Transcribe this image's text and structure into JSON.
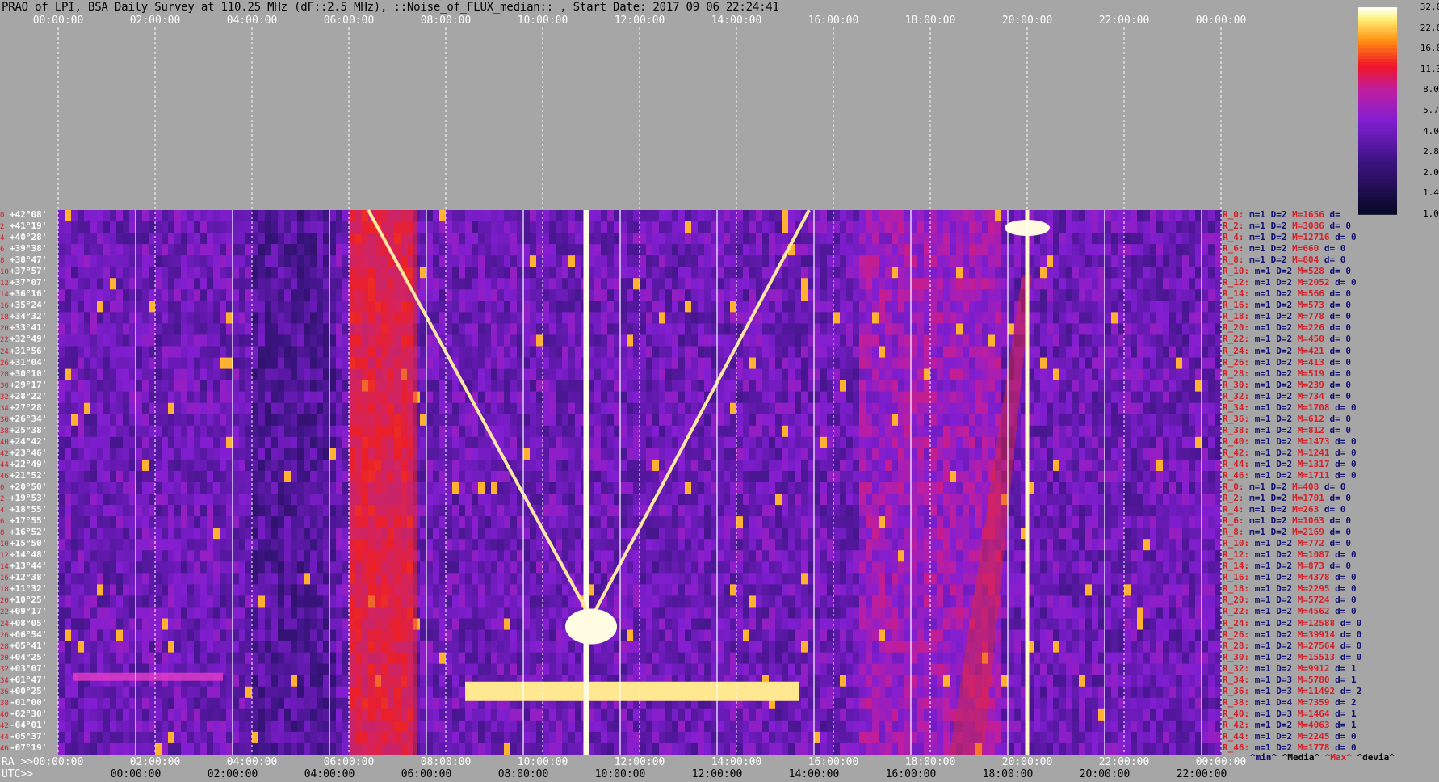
{
  "title": "PRAO of LPI, BSA Daily Survey at 110.25 MHz (dF::2.5 MHz), ::Noise_of_FLUX_median:: , Start Date: 2017 09 06 22:24:41",
  "top_axis": {
    "labels": [
      "00:00:00",
      "02:00:00",
      "04:00:00",
      "06:00:00",
      "08:00:00",
      "10:00:00",
      "12:00:00",
      "14:00:00",
      "16:00:00",
      "18:00:00",
      "20:00:00",
      "22:00:00",
      "00:00:00"
    ]
  },
  "ra_axis": {
    "prefix": "RA >>",
    "labels": [
      "00:00:00",
      "02:00:00",
      "04:00:00",
      "06:00:00",
      "08:00:00",
      "10:00:00",
      "12:00:00",
      "14:00:00",
      "16:00:00",
      "18:00:00",
      "20:00:00",
      "22:00:00",
      "00:00:00"
    ]
  },
  "utc_axis": {
    "prefix": "UTC>>",
    "labels": [
      "00:00:00",
      "02:00:00",
      "04:00:00",
      "06:00:00",
      "08:00:00",
      "10:00:00",
      "12:00:00",
      "14:00:00",
      "16:00:00",
      "18:00:00",
      "20:00:00",
      "22:00:00"
    ]
  },
  "colorbar": {
    "ticks": [
      "32.0",
      "22.6",
      "16.0",
      "11.3",
      "8.0",
      "5.7",
      "4.0",
      "2.8",
      "2.0",
      "1.4",
      "1.0"
    ]
  },
  "legend": {
    "min": "^min^",
    "median": "^Media^",
    "max": "^Max^",
    "dev": "^devia^"
  },
  "colors": {
    "background": "#a6a6a6",
    "low": "#0a0a30",
    "mid": "#8020d0",
    "high": "#ff2020",
    "peak": "#ffffe0",
    "label_red": "#d8202a",
    "label_blue": "#101070"
  },
  "rows": [
    {
      "idx": "0",
      "dec": "+42°08'",
      "stat_r": "R_0:",
      "stat_a": "m=1 D=2",
      "stat_m": "M=1656",
      "stat_d": "d="
    },
    {
      "idx": "2",
      "dec": "+41°19'",
      "stat_r": "R_2:",
      "stat_a": "m=1 D=2",
      "stat_m": "M=3086",
      "stat_d": "d= 0"
    },
    {
      "idx": "4",
      "dec": "+40°28'",
      "stat_r": "R_4:",
      "stat_a": "m=1 D=2",
      "stat_m": "M=12716",
      "stat_d": "d= 0"
    },
    {
      "idx": "6",
      "dec": "+39°38'",
      "stat_r": "R_6:",
      "stat_a": "m=1 D=2",
      "stat_m": "M=660",
      "stat_d": "d= 0"
    },
    {
      "idx": "8",
      "dec": "+38°47'",
      "stat_r": "R_8:",
      "stat_a": "m=1 D=2",
      "stat_m": "M=804",
      "stat_d": "d= 0"
    },
    {
      "idx": "10",
      "dec": "+37°57'",
      "stat_r": "R_10:",
      "stat_a": "m=1 D=2",
      "stat_m": "M=528",
      "stat_d": "d= 0"
    },
    {
      "idx": "12",
      "dec": "+37°07'",
      "stat_r": "R_12:",
      "stat_a": "m=1 D=2",
      "stat_m": "M=2052",
      "stat_d": "d= 0"
    },
    {
      "idx": "14",
      "dec": "+36°16'",
      "stat_r": "R_14:",
      "stat_a": "m=1 D=2",
      "stat_m": "M=566",
      "stat_d": "d= 0"
    },
    {
      "idx": "16",
      "dec": "+35°24'",
      "stat_r": "R_16:",
      "stat_a": "m=1 D=2",
      "stat_m": "M=573",
      "stat_d": "d= 0"
    },
    {
      "idx": "18",
      "dec": "+34°32'",
      "stat_r": "R_18:",
      "stat_a": "m=1 D=2",
      "stat_m": "M=778",
      "stat_d": "d= 0"
    },
    {
      "idx": "20",
      "dec": "+33°41'",
      "stat_r": "R_20:",
      "stat_a": "m=1 D=2",
      "stat_m": "M=226",
      "stat_d": "d= 0"
    },
    {
      "idx": "22",
      "dec": "+32°49'",
      "stat_r": "R_22:",
      "stat_a": "m=1 D=2",
      "stat_m": "M=450",
      "stat_d": "d= 0"
    },
    {
      "idx": "24",
      "dec": "+31°56'",
      "stat_r": "R_24:",
      "stat_a": "m=1 D=2",
      "stat_m": "M=421",
      "stat_d": "d= 0"
    },
    {
      "idx": "26",
      "dec": "+31°04'",
      "stat_r": "R_26:",
      "stat_a": "m=1 D=2",
      "stat_m": "M=413",
      "stat_d": "d= 0"
    },
    {
      "idx": "28",
      "dec": "+30°10'",
      "stat_r": "R_28:",
      "stat_a": "m=1 D=2",
      "stat_m": "M=519",
      "stat_d": "d= 0"
    },
    {
      "idx": "30",
      "dec": "+29°17'",
      "stat_r": "R_30:",
      "stat_a": "m=1 D=2",
      "stat_m": "M=239",
      "stat_d": "d= 0"
    },
    {
      "idx": "32",
      "dec": "+28°22'",
      "stat_r": "R_32:",
      "stat_a": "m=1 D=2",
      "stat_m": "M=734",
      "stat_d": "d= 0"
    },
    {
      "idx": "34",
      "dec": "+27°28'",
      "stat_r": "R_34:",
      "stat_a": "m=1 D=2",
      "stat_m": "M=1708",
      "stat_d": "d= 0"
    },
    {
      "idx": "36",
      "dec": "+26°34'",
      "stat_r": "R_36:",
      "stat_a": "m=1 D=2",
      "stat_m": "M=612",
      "stat_d": "d= 0"
    },
    {
      "idx": "38",
      "dec": "+25°38'",
      "stat_r": "R_38:",
      "stat_a": "m=1 D=2",
      "stat_m": "M=812",
      "stat_d": "d= 0"
    },
    {
      "idx": "40",
      "dec": "+24°42'",
      "stat_r": "R_40:",
      "stat_a": "m=1 D=2",
      "stat_m": "M=1473",
      "stat_d": "d= 0"
    },
    {
      "idx": "42",
      "dec": "+23°46'",
      "stat_r": "R_42:",
      "stat_a": "m=1 D=2",
      "stat_m": "M=1241",
      "stat_d": "d= 0"
    },
    {
      "idx": "44",
      "dec": "+22°49'",
      "stat_r": "R_44:",
      "stat_a": "m=1 D=2",
      "stat_m": "M=1317",
      "stat_d": "d= 0"
    },
    {
      "idx": "46",
      "dec": "+21°52'",
      "stat_r": "R_46:",
      "stat_a": "m=1 D=2",
      "stat_m": "M=1711",
      "stat_d": "d= 0"
    },
    {
      "idx": "0",
      "dec": "+20°50'",
      "stat_r": "R_0:",
      "stat_a": "m=1 D=2",
      "stat_m": "M=408",
      "stat_d": "d= 0"
    },
    {
      "idx": "2",
      "dec": "+19°53'",
      "stat_r": "R_2:",
      "stat_a": "m=1 D=2",
      "stat_m": "M=1701",
      "stat_d": "d= 0"
    },
    {
      "idx": "4",
      "dec": "+18°55'",
      "stat_r": "R_4:",
      "stat_a": "m=1 D=2",
      "stat_m": "M=263",
      "stat_d": "d= 0"
    },
    {
      "idx": "6",
      "dec": "+17°55'",
      "stat_r": "R_6:",
      "stat_a": "m=1 D=2",
      "stat_m": "M=1063",
      "stat_d": "d= 0"
    },
    {
      "idx": "8",
      "dec": "+16°52'",
      "stat_r": "R_8:",
      "stat_a": "m=1 D=2",
      "stat_m": "M=2169",
      "stat_d": "d= 0"
    },
    {
      "idx": "10",
      "dec": "+15°50'",
      "stat_r": "R_10:",
      "stat_a": "m=1 D=2",
      "stat_m": "M=772",
      "stat_d": "d= 0"
    },
    {
      "idx": "12",
      "dec": "+14°48'",
      "stat_r": "R_12:",
      "stat_a": "m=1 D=2",
      "stat_m": "M=1087",
      "stat_d": "d= 0"
    },
    {
      "idx": "14",
      "dec": "+13°44'",
      "stat_r": "R_14:",
      "stat_a": "m=1 D=2",
      "stat_m": "M=873",
      "stat_d": "d= 0"
    },
    {
      "idx": "16",
      "dec": "+12°38'",
      "stat_r": "R_16:",
      "stat_a": "m=1 D=2",
      "stat_m": "M=4378",
      "stat_d": "d= 0"
    },
    {
      "idx": "18",
      "dec": "+11°32'",
      "stat_r": "R_18:",
      "stat_a": "m=1 D=2",
      "stat_m": "M=2295",
      "stat_d": "d= 0"
    },
    {
      "idx": "20",
      "dec": "+10°25'",
      "stat_r": "R_20:",
      "stat_a": "m=1 D=2",
      "stat_m": "M=5724",
      "stat_d": "d= 0"
    },
    {
      "idx": "22",
      "dec": "+09°17'",
      "stat_r": "R_22:",
      "stat_a": "m=1 D=2",
      "stat_m": "M=4562",
      "stat_d": "d= 0"
    },
    {
      "idx": "24",
      "dec": "+08°05'",
      "stat_r": "R_24:",
      "stat_a": "m=1 D=2",
      "stat_m": "M=12588",
      "stat_d": "d= 0"
    },
    {
      "idx": "26",
      "dec": "+06°54'",
      "stat_r": "R_26:",
      "stat_a": "m=1 D=2",
      "stat_m": "M=39914",
      "stat_d": "d= 0"
    },
    {
      "idx": "28",
      "dec": "+05°41'",
      "stat_r": "R_28:",
      "stat_a": "m=1 D=2",
      "stat_m": "M=27564",
      "stat_d": "d= 0"
    },
    {
      "idx": "30",
      "dec": "+04°25'",
      "stat_r": "R_30:",
      "stat_a": "m=1 D=2",
      "stat_m": "M=15513",
      "stat_d": "d= 0"
    },
    {
      "idx": "32",
      "dec": "+03°07'",
      "stat_r": "R_32:",
      "stat_a": "m=1 D=2",
      "stat_m": "M=9912",
      "stat_d": "d= 1"
    },
    {
      "idx": "34",
      "dec": "+01°47'",
      "stat_r": "R_34:",
      "stat_a": "m=1 D=3",
      "stat_m": "M=5780",
      "stat_d": "d= 1"
    },
    {
      "idx": "36",
      "dec": "+00°25'",
      "stat_r": "R_36:",
      "stat_a": "m=1 D=3",
      "stat_m": "M=11492",
      "stat_d": "d= 2"
    },
    {
      "idx": "38",
      "dec": "-01°00'",
      "stat_r": "R_38:",
      "stat_a": "m=1 D=4",
      "stat_m": "M=7359",
      "stat_d": "d= 2"
    },
    {
      "idx": "40",
      "dec": "-02°30'",
      "stat_r": "R_40:",
      "stat_a": "m=1 D=3",
      "stat_m": "M=1464",
      "stat_d": "d= 1"
    },
    {
      "idx": "42",
      "dec": "-04°01'",
      "stat_r": "R_42:",
      "stat_a": "m=1 D=2",
      "stat_m": "M=4063",
      "stat_d": "d= 1"
    },
    {
      "idx": "44",
      "dec": "-05°37'",
      "stat_r": "R_44:",
      "stat_a": "m=1 D=2",
      "stat_m": "M=2245",
      "stat_d": "d= 0"
    },
    {
      "idx": "46",
      "dec": "-07°19'",
      "stat_r": "R_46:",
      "stat_a": "m=1 D=2",
      "stat_m": "M=1778",
      "stat_d": "d= 0"
    }
  ],
  "chart_data": {
    "type": "heatmap",
    "title": "PRAO of LPI, BSA Daily Survey at 110.25 MHz (dF::2.5 MHz), ::Noise_of_FLUX_median:: , Start Date: 2017 09 06 22:24:41",
    "x_axis": "RA / UTC time 00:00:00 – 24:00:00",
    "y_axis": "declination rows +42°08' to -07°19' (48 rows)",
    "colorbar_range": [
      1.0,
      32.0
    ],
    "colorbar_scale": "log",
    "features": [
      {
        "name": "vertical bright source track",
        "ra_hours": 10.9,
        "rows": "all",
        "level": 32.0
      },
      {
        "name": "vertical bright source track",
        "ra_hours": 20.0,
        "rows": "all",
        "level": 32.0
      },
      {
        "name": "V-shaped arc minimum",
        "ra_hours": 11.0,
        "row_dec": "+06°54'",
        "level": 32.0
      },
      {
        "name": "horizontal bright band",
        "ra_hours_range": [
          8.4,
          15.3
        ],
        "row_dec": "+00°25'",
        "level": 32.0
      },
      {
        "name": "red interference band",
        "ra_hours_range": [
          6.0,
          7.4
        ],
        "rows": "all",
        "level": 8.0
      }
    ]
  }
}
